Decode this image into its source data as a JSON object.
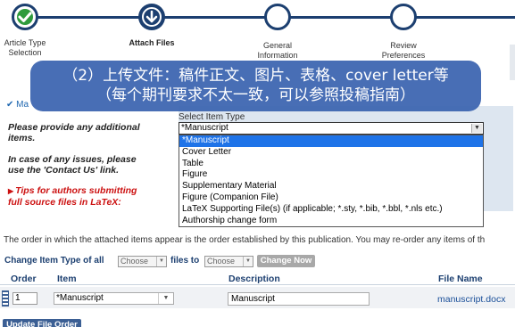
{
  "steps": [
    {
      "label_line1": "Article Type",
      "label_line2": "Selection",
      "state": "done"
    },
    {
      "label_line1": "Attach Files",
      "label_line2": "",
      "state": "current"
    },
    {
      "label_line1": "General",
      "label_line2": "Information",
      "state": "future"
    },
    {
      "label_line1": "Review",
      "label_line2": "Preferences",
      "state": "future"
    }
  ],
  "banner": {
    "line1": "（2）上传文件：稿件正文、图片、表格、cover letter等",
    "line2": "（每个期刊要求不太一致，可以参照投稿指南）"
  },
  "left": {
    "check_text": "✔ Ma",
    "provide": "Please provide any additional items.",
    "issues": "In case of any issues, please use the 'Contact Us' link.",
    "tips": "Tips for authors submitting full source files in LaTeX:"
  },
  "select_panel": {
    "label": "Select Item Type",
    "current_value": "*Manuscript",
    "options": [
      "*Manuscript",
      "Cover Letter",
      "Table",
      "Figure",
      "Supplementary Material",
      "Figure (Companion File)",
      "LaTeX Supporting File(s) (if applicable; *.sty, *.bib, *.bbl, *.nls etc.)",
      "Authorship change form"
    ],
    "selected_index": 0
  },
  "order_note": "The order in which the attached items appear is the order established by this publication. You may re-order any items of th",
  "change_row": {
    "prefix": "Change Item Type of all",
    "from_value": "Choose",
    "files_to": "files to",
    "to_value": "Choose",
    "button": "Change Now"
  },
  "table": {
    "headers": [
      "Order",
      "Item",
      "Description",
      "File Name"
    ],
    "rows": [
      {
        "order": "1",
        "item": "*Manuscript",
        "description": "Manuscript",
        "file": "manuscript.docx"
      }
    ]
  },
  "update_button": "Update File Order",
  "colors": {
    "navy": "#1c3f70",
    "done_green": "#2e9b3c",
    "banner_blue": "#3a63af",
    "tips_red": "#cc1111",
    "highlight": "#1e73e8"
  },
  "icons": {
    "step1": "checkmark-icon",
    "step2": "down-arrow-icon"
  }
}
